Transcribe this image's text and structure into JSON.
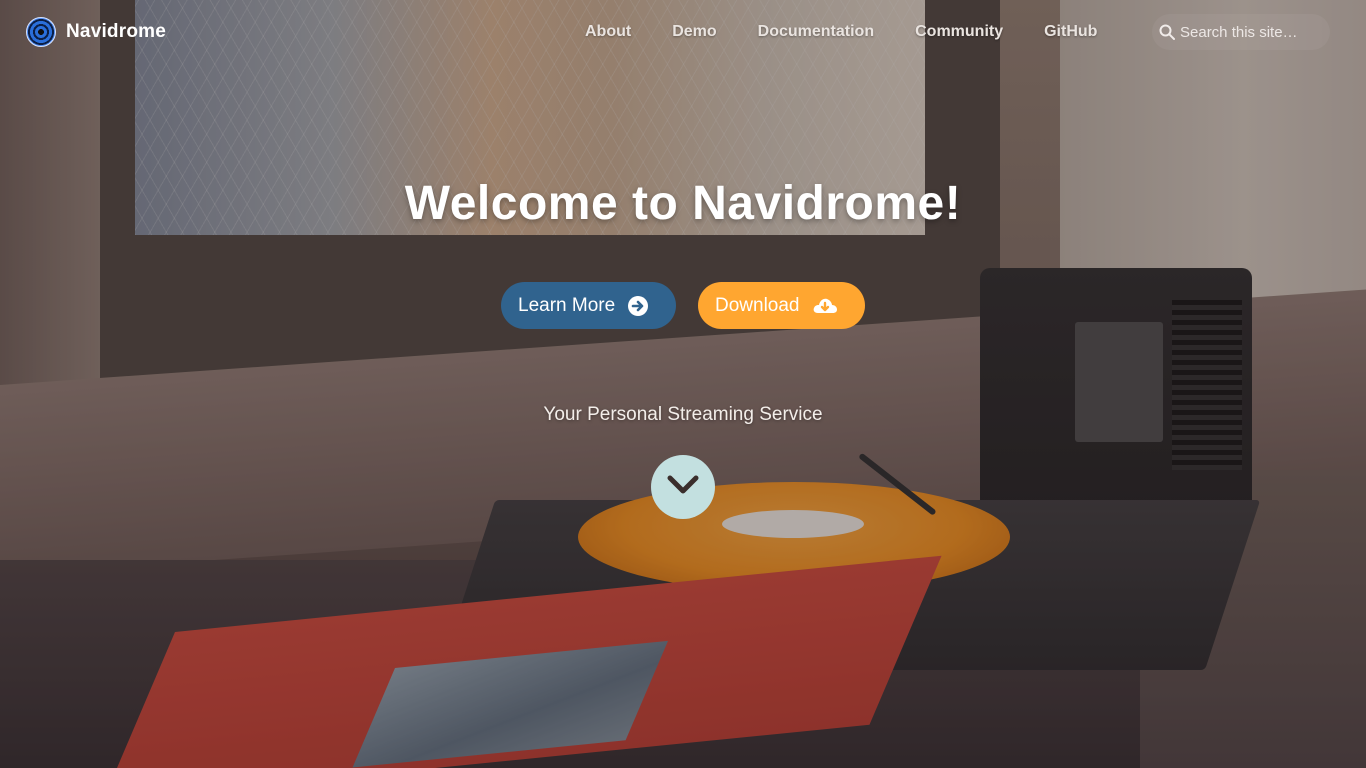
{
  "site": {
    "brand_name": "Navidrome",
    "logo_icon": "record-disc-icon"
  },
  "nav": {
    "links": [
      {
        "label": "About"
      },
      {
        "label": "Demo"
      },
      {
        "label": "Documentation"
      },
      {
        "label": "Community"
      },
      {
        "label": "GitHub"
      }
    ]
  },
  "search": {
    "placeholder": "Search this site…",
    "icon": "search-icon"
  },
  "hero": {
    "title": "Welcome to Navidrome!",
    "buttons": {
      "learn_more": {
        "label": "Learn More",
        "icon": "arrow-circle-right-icon",
        "color": "#30638e"
      },
      "download": {
        "label": "Download",
        "icon": "cloud-download-icon",
        "color": "#ffa630"
      }
    },
    "tagline": "Your Personal Streaming Service",
    "scroll_icon": "chevron-down-icon",
    "scroll_color": "#c3e0e0"
  }
}
